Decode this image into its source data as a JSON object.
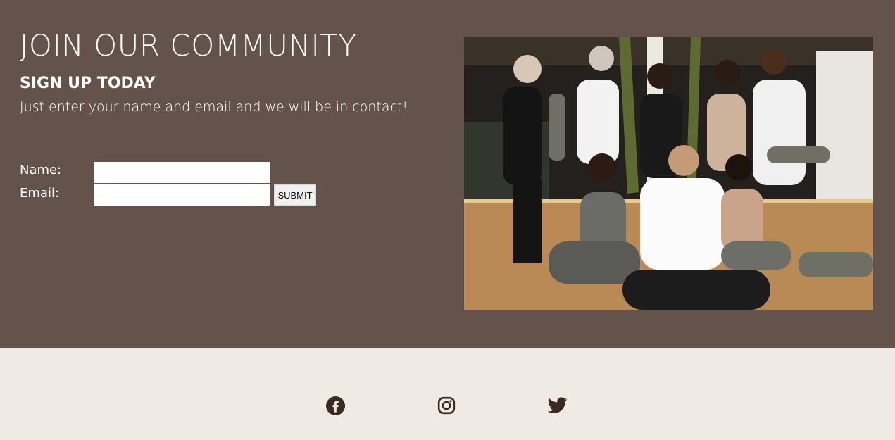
{
  "community": {
    "heading": "JOIN OUR COMMUNITY",
    "subheading": "SIGN UP TODAY",
    "tagline": "Just enter your name and email and we will be in contact!"
  },
  "form": {
    "name_label": "Name:",
    "email_label": "Email:",
    "name_value": "",
    "email_value": "",
    "submit_label": "SUBMIT"
  },
  "photo": {
    "icon": "group-yoga-photo"
  },
  "footer": {
    "social": [
      {
        "icon": "facebook-icon"
      },
      {
        "icon": "instagram-icon"
      },
      {
        "icon": "twitter-icon"
      }
    ]
  },
  "colors": {
    "section_background": "#63534a",
    "footer_background": "#efebe4",
    "text_light": "#ffffff",
    "icon_dark": "#3b2a1f"
  }
}
